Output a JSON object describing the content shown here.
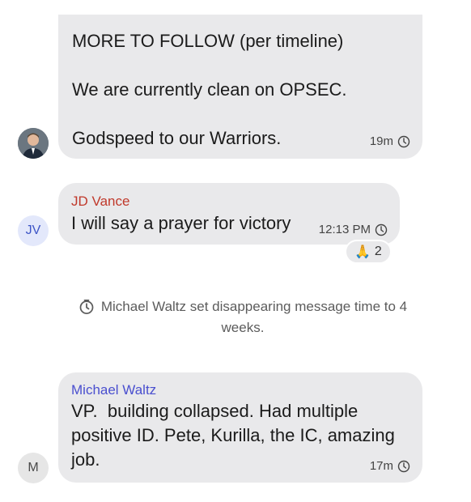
{
  "colors": {
    "bubble": "#e9e9eb",
    "jd_vance_name": "#c0392b",
    "michael_waltz_name": "#4a4fcf",
    "jv_avatar_bg": "#e3e8fb",
    "jv_avatar_text": "#3f56c7"
  },
  "messages": [
    {
      "sender": "",
      "avatar": "photo",
      "text": "MORE TO FOLLOW (per timeline)\n\nWe are currently clean on OPSEC.\n\nGodspeed to our Warriors.",
      "time": "19m",
      "timer_icon": "timer-icon"
    },
    {
      "sender": "JD Vance",
      "avatar": "JV",
      "text": "I will say a prayer for victory",
      "time": "12:13 PM",
      "timer_icon": "timer-icon",
      "reaction": {
        "emoji": "🙏",
        "count": "2"
      }
    },
    {
      "sender": "Michael Waltz",
      "avatar": "M",
      "text": "VP.  building collapsed. Had multiple\npositive ID. Pete, Kurilla, the IC, amazing\njob.",
      "time": "17m",
      "timer_icon": "timer-icon"
    }
  ],
  "system_notice": {
    "line1": "Michael Waltz set disappearing message time to 4",
    "line2": "weeks.",
    "icon": "timer-icon"
  }
}
